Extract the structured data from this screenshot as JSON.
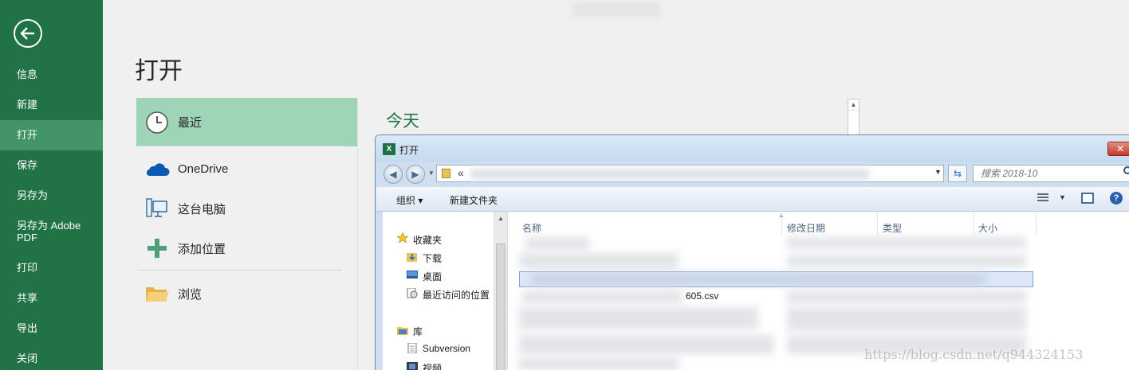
{
  "rail": {
    "items": [
      "信息",
      "新建",
      "打开",
      "保存",
      "另存为",
      "另存为 Adobe PDF",
      "打印",
      "共享",
      "导出",
      "关闭"
    ],
    "active_index": 2
  },
  "main": {
    "title": "打开",
    "locations": [
      {
        "label": "最近",
        "icon": "clock-icon"
      },
      {
        "label": "OneDrive",
        "icon": "cloud-icon"
      },
      {
        "label": "这台电脑",
        "icon": "computer-icon"
      },
      {
        "label": "添加位置",
        "icon": "plus-icon"
      },
      {
        "label": "浏览",
        "icon": "folder-icon"
      }
    ],
    "section": "今天"
  },
  "dialog": {
    "title": "打开",
    "breadcrumb_prefix": "«",
    "search_placeholder": "搜索 2018-10",
    "toolbar": {
      "organize": "组织 ▾",
      "new_folder": "新建文件夹"
    },
    "nav": {
      "favorites_header": "收藏夹",
      "favorites": [
        "下载",
        "桌面",
        "最近访问的位置"
      ],
      "library_header": "库",
      "library": [
        "Subversion",
        "视频"
      ]
    },
    "columns": [
      "名称",
      "修改日期",
      "类型",
      "大小"
    ],
    "visible_file_fragment": "605.csv"
  },
  "watermark": "https://blog.csdn.net/q944324153",
  "colors": {
    "brand": "#217346",
    "rail_active": "#439467",
    "location_active": "#9fd5b7"
  }
}
